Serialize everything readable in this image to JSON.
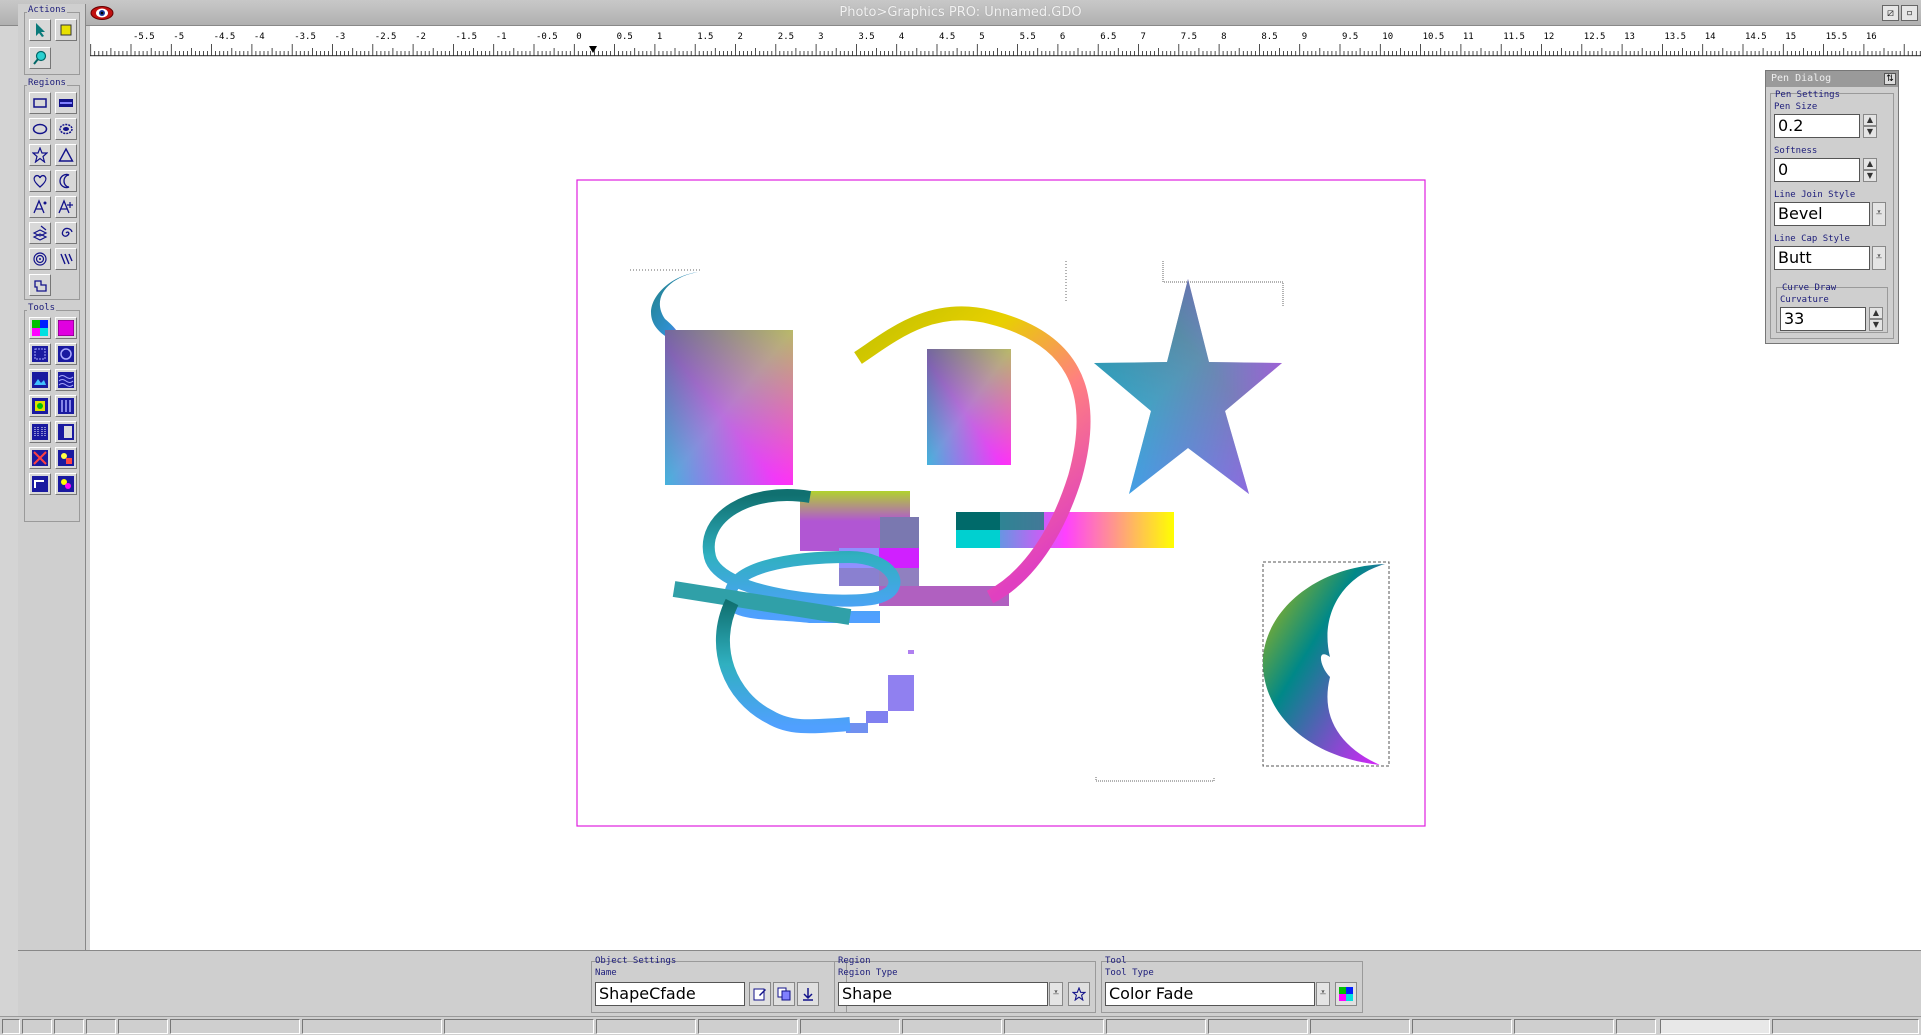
{
  "window": {
    "title": "Photo>Graphics PRO: Unnamed.GDO",
    "min_icon": "restore-icon",
    "close_icon": "close-icon"
  },
  "left_panel": {
    "actions_label": "Actions",
    "regions_label": "Regions",
    "tools_label": "Tools"
  },
  "ruler": {
    "labels": [
      "-5.5",
      "-5",
      "-4.5",
      "-4",
      "-3.5",
      "-3",
      "-2.5",
      "-2",
      "-1.5",
      "-1",
      "-0.5",
      "0",
      "0.5",
      "1",
      "1.5",
      "2",
      "2.5",
      "3",
      "3.5",
      "4",
      "4.5",
      "5",
      "5.5",
      "6",
      "6.5",
      "7",
      "7.5",
      "8",
      "8.5",
      "9",
      "9.5",
      "10",
      "10.5",
      "11",
      "11.5",
      "12",
      "12.5",
      "13",
      "13.5",
      "14",
      "14.5",
      "15",
      "15.5",
      "16"
    ]
  },
  "pen_dialog": {
    "title": "Pen Dialog",
    "settings_label": "Pen Settings",
    "pen_size_label": "Pen Size",
    "pen_size_value": "0.2",
    "softness_label": "Softness",
    "softness_value": "0",
    "join_label": "Line Join Style",
    "join_value": "Bevel",
    "cap_label": "Line Cap Style",
    "cap_value": "Butt",
    "curve_label": "Curve Draw",
    "curvature_label": "Curvature",
    "curvature_value": "33"
  },
  "bottom": {
    "object_settings_label": "Object Settings",
    "name_label": "Name",
    "name_value": "ShapeCfade",
    "region_label": "Region",
    "region_type_label": "Region Type",
    "region_type_value": "Shape",
    "tool_label": "Tool",
    "tool_type_label": "Tool Type",
    "tool_type_value": "Color Fade"
  },
  "colors": {
    "page_border": "#e020e0",
    "gradient": [
      "#00e5ff",
      "#ff00ff",
      "#ffff00",
      "#008080"
    ]
  }
}
